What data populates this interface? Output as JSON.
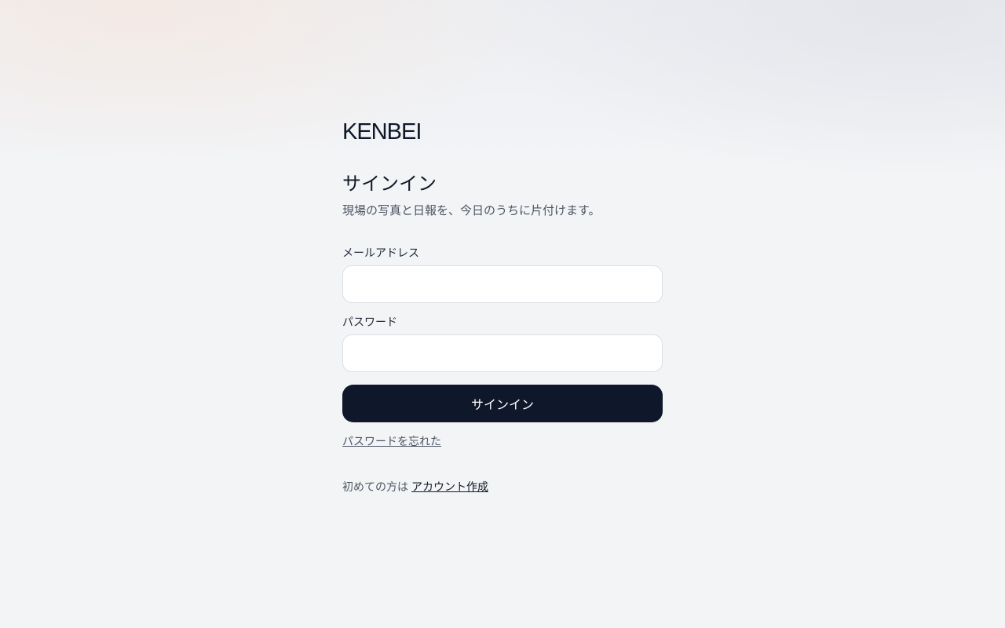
{
  "brand": {
    "logo_text": "KENBEI"
  },
  "signin": {
    "title": "サインイン",
    "subtitle": "現場の写真と日報を、今日のうちに片付けます。",
    "email_label": "メールアドレス",
    "email_value": "",
    "password_label": "パスワード",
    "password_value": "",
    "submit_label": "サインイン",
    "forgot_label": "パスワードを忘れた"
  },
  "signup": {
    "prompt": "初めての方は",
    "link_label": "アカウント作成"
  },
  "colors": {
    "primary": "#0f172a",
    "background": "#f3f4f6",
    "muted_text": "#4b5563"
  }
}
